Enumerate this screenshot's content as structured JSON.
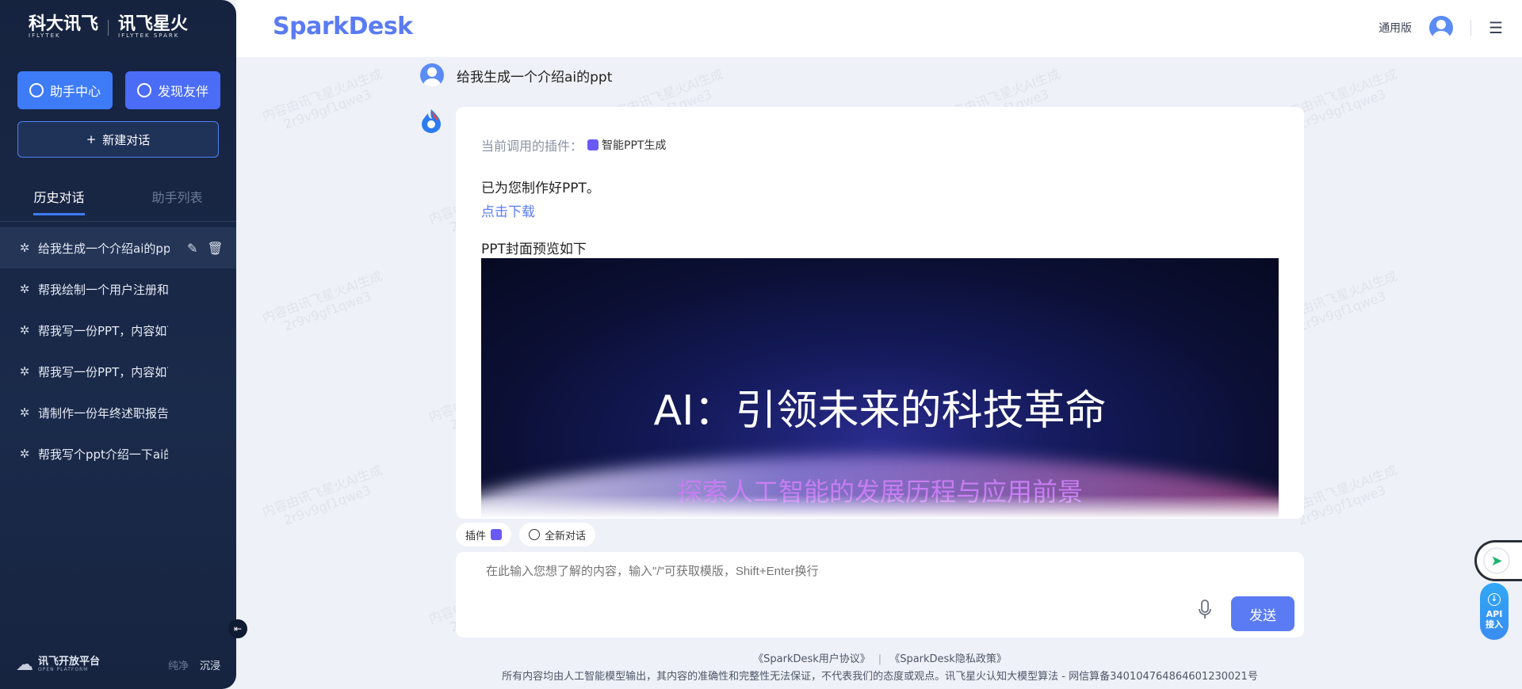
{
  "sidebar": {
    "logo_iflytek": "科大讯飞",
    "logo_iflytek_sub": "IFLYTEK",
    "logo_spark": "讯飞星火",
    "logo_spark_sub": "IFLYTEK SPARK",
    "assistant_center": "助手中心",
    "discover_partner": "发现友伴",
    "new_chat": "新建对话",
    "tab_history": "历史对话",
    "tab_assistants": "助手列表",
    "history": [
      {
        "title": "给我生成一个介绍ai的ppt"
      },
      {
        "title": "帮我绘制一个用户注册和登录流程"
      },
      {
        "title": "帮我写一份PPT，内容如下：G"
      },
      {
        "title": "帮我写一份PPT，内容如下：G"
      },
      {
        "title": "请制作一份年终述职报告PPT模"
      },
      {
        "title": "帮我写个ppt介绍一下ai的发"
      }
    ],
    "footer_platform": "讯飞开放平台",
    "footer_platform_sub": "OPEN PLATFORM",
    "mode_pure": "纯净",
    "mode_immersive": "沉浸"
  },
  "header": {
    "brand": "SparkDesk",
    "version": "通用版"
  },
  "chat": {
    "user_message": "给我生成一个介绍ai的ppt",
    "plugin_label": "当前调用的插件：",
    "plugin_name": "智能PPT生成",
    "done_text": "已为您制作好PPT。",
    "download_link": "点击下载",
    "preview_label": "PPT封面预览如下",
    "ppt_title": "AI：引领未来的科技革命",
    "ppt_subtitle": "探索人工智能的发展历程与应用前景"
  },
  "chips": {
    "plugin": "插件",
    "new_chat": "全新对话"
  },
  "input": {
    "placeholder": "在此输入您想了解的内容，输入\"/\"可获取模版，Shift+Enter换行",
    "send": "发送"
  },
  "footer": {
    "agreement": "《SparkDesk用户协议》",
    "privacy": "《SparkDesk隐私政策》",
    "note": "所有内容均由人工智能模型输出，其内容的准确性和完整性无法保证，不代表我们的态度或观点。讯飞星火认知大模型算法 - 网信算备340104764864601230021号"
  },
  "floating": {
    "api_line1": "API",
    "api_line2": "接入"
  },
  "watermark": {
    "line1": "内容由讯飞星火AI生成",
    "line2": "2r9v9gf1qwe3"
  },
  "colors": {
    "accent": "#5a7bf3",
    "sidebar_bg": "#16233f",
    "page_bg": "#eef1f7"
  }
}
